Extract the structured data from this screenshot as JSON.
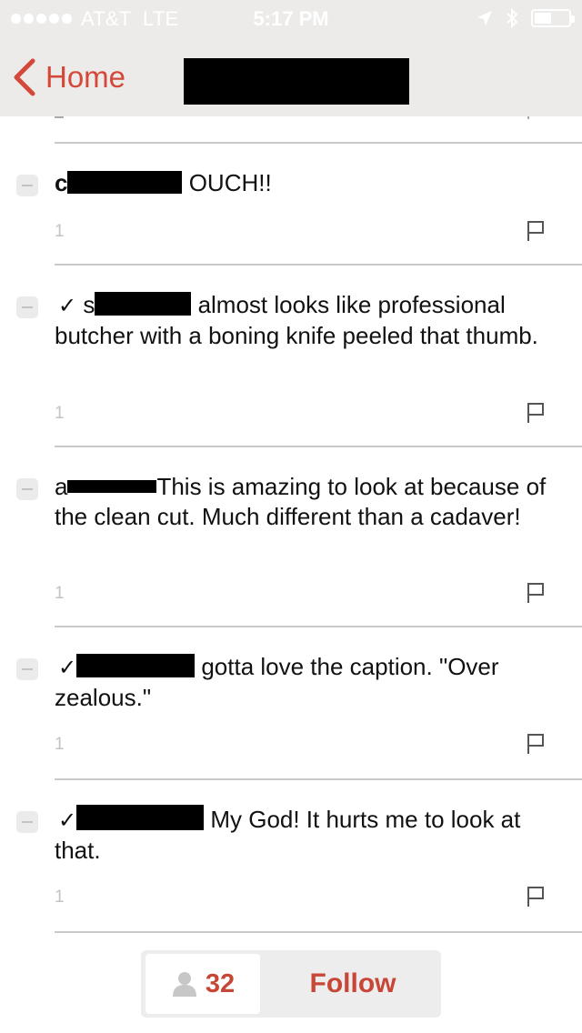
{
  "status_bar": {
    "carrier": "AT&T",
    "network": "LTE",
    "time": "5:17 PM",
    "signal_bars": 5,
    "location_icon": "location-arrow-icon",
    "bluetooth_icon": "bluetooth-icon",
    "battery_icon": "battery-icon",
    "battery_level": 0.4
  },
  "nav": {
    "back_label": "Home",
    "back_icon": "chevron-left-icon",
    "title_redacted": true
  },
  "comments": [
    {
      "checkmark": "",
      "name_initial": "c",
      "text": " OUCH!!",
      "count": "1"
    },
    {
      "checkmark": "✓",
      "name_initial": "s",
      "text": " almost looks like professional butcher with a boning knife peeled that thumb.",
      "count": "1"
    },
    {
      "checkmark": "",
      "name_initial": "a",
      "text": "This is amazing to look at because of the clean cut. Much different than a cadaver!",
      "count": "1"
    },
    {
      "checkmark": "✓",
      "name_initial": "",
      "text": " gotta love the caption. \"Over zealous.\"",
      "count": "1"
    },
    {
      "checkmark": "✓",
      "name_initial": "",
      "text": " My God!  It hurts me to look at that.",
      "count": "1"
    }
  ],
  "footer": {
    "followers_count": "32",
    "follow_label": "Follow",
    "person_icon": "person-icon"
  },
  "colors": {
    "accent": "#d4483a",
    "nav_background": "#edebe9",
    "separator": "#c9c9c9",
    "muted_text": "#c3c3c3"
  }
}
